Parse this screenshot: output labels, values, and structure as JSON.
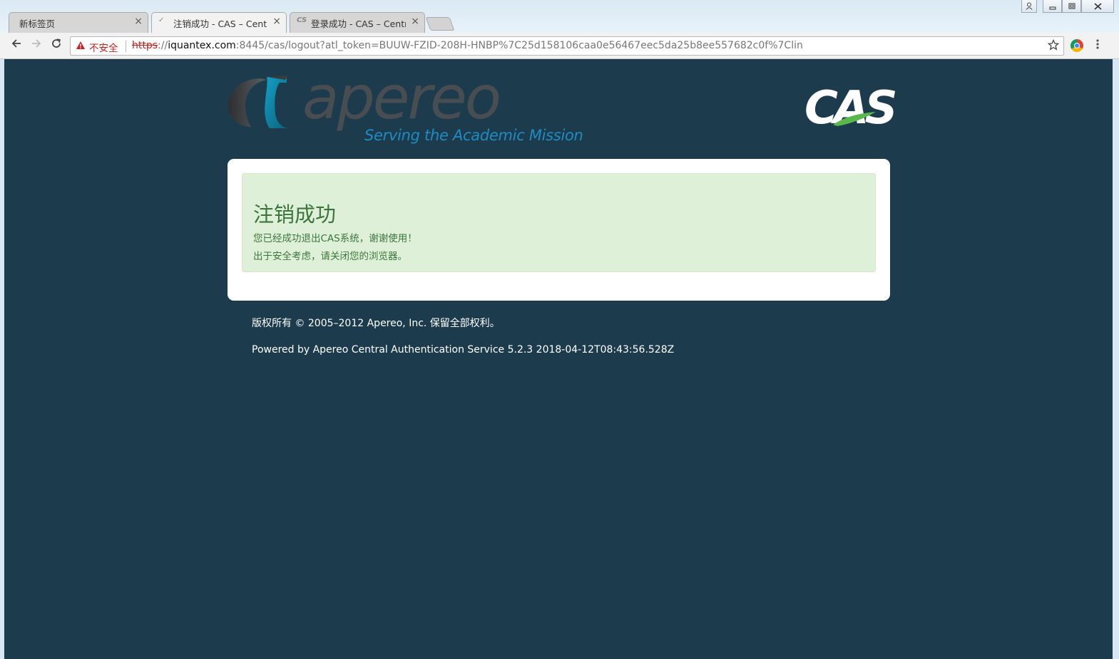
{
  "browser": {
    "tabs": [
      {
        "title": "新标签页",
        "active": false
      },
      {
        "title": "注销成功 - CAS – Centr",
        "active": true
      },
      {
        "title": "登录成功 - CAS – Centr",
        "active": false
      }
    ],
    "close_glyph": "×",
    "security_label": "不安全",
    "url": {
      "scheme": "https",
      "separator": "://",
      "host": "iquantex.com",
      "rest": ":8445/cas/logout?atl_token=BUUW-FZID-208H-HNBP%7C25d158106caa0e56467eec5da25b8ee557682c0f%7Clin"
    },
    "icons": [
      "back-icon",
      "forward-icon",
      "reload-icon",
      "warning-icon",
      "star-icon",
      "extension-icon",
      "menu-icon",
      "profile-icon",
      "minimize-icon",
      "restore-icon",
      "close-icon"
    ]
  },
  "page": {
    "apereo_word": "apereo",
    "apereo_tagline": "Serving the Academic Mission",
    "cas_logo": "CAS",
    "alert": {
      "title": "注销成功",
      "line1": "您已经成功退出CAS系统，谢谢使用！",
      "line2": "出于安全考虑，请关闭您的浏览器。"
    },
    "footer": {
      "copyright": "版权所有 © 2005–2012 Apereo, Inc. 保留全部权利。",
      "powered": "Powered by Apereo Central Authentication Service 5.2.3 2018-04-12T08:43:56.528Z"
    }
  },
  "colors": {
    "page_bg": "#1c3c4e",
    "alert_bg": "#dff0d8",
    "alert_text": "#3c763d",
    "insecure": "#c5221f",
    "tagline": "#1e8bc3"
  }
}
